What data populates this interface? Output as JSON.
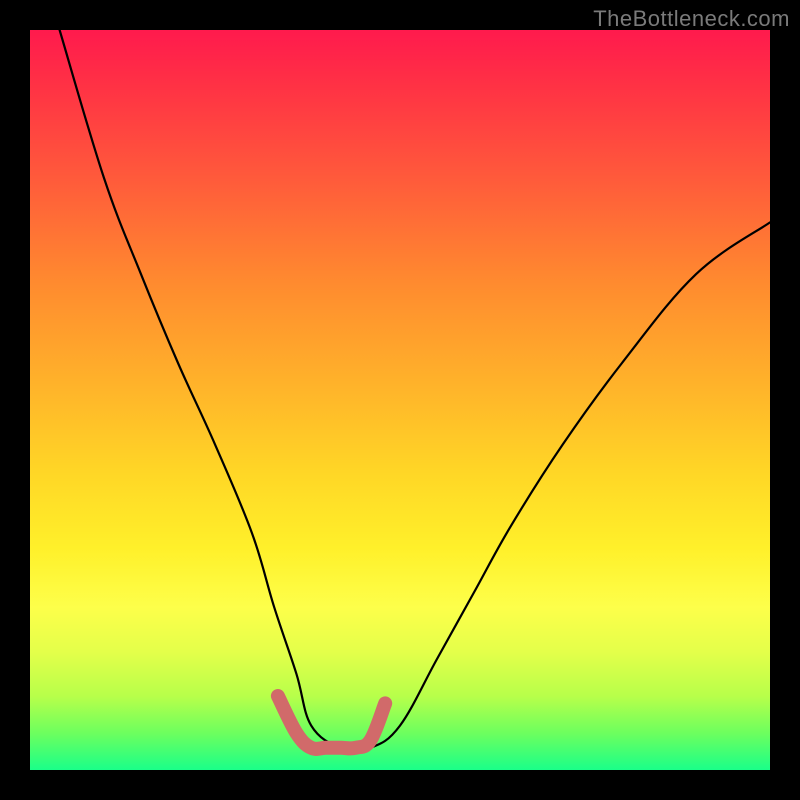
{
  "watermark": "TheBottleneck.com",
  "chart_data": {
    "type": "line",
    "title": "",
    "xlabel": "",
    "ylabel": "",
    "xlim": [
      0,
      100
    ],
    "ylim": [
      0,
      100
    ],
    "series": [
      {
        "name": "main-curve",
        "color": "#000000",
        "x": [
          4,
          10,
          15,
          20,
          25,
          30,
          33,
          36,
          38,
          42,
          46,
          50,
          55,
          60,
          65,
          72,
          80,
          90,
          100
        ],
        "values": [
          100,
          80,
          67,
          55,
          44,
          32,
          22,
          13,
          6,
          3,
          3,
          6,
          15,
          24,
          33,
          44,
          55,
          67,
          74
        ]
      },
      {
        "name": "highlight-bottom",
        "color": "#d16a6a",
        "x": [
          33.5,
          36,
          38,
          40,
          42,
          44,
          46,
          48
        ],
        "values": [
          10,
          5,
          3,
          3,
          3,
          3,
          4,
          9
        ]
      }
    ]
  },
  "colors": {
    "black": "#000000",
    "highlight": "#d16a6a"
  }
}
